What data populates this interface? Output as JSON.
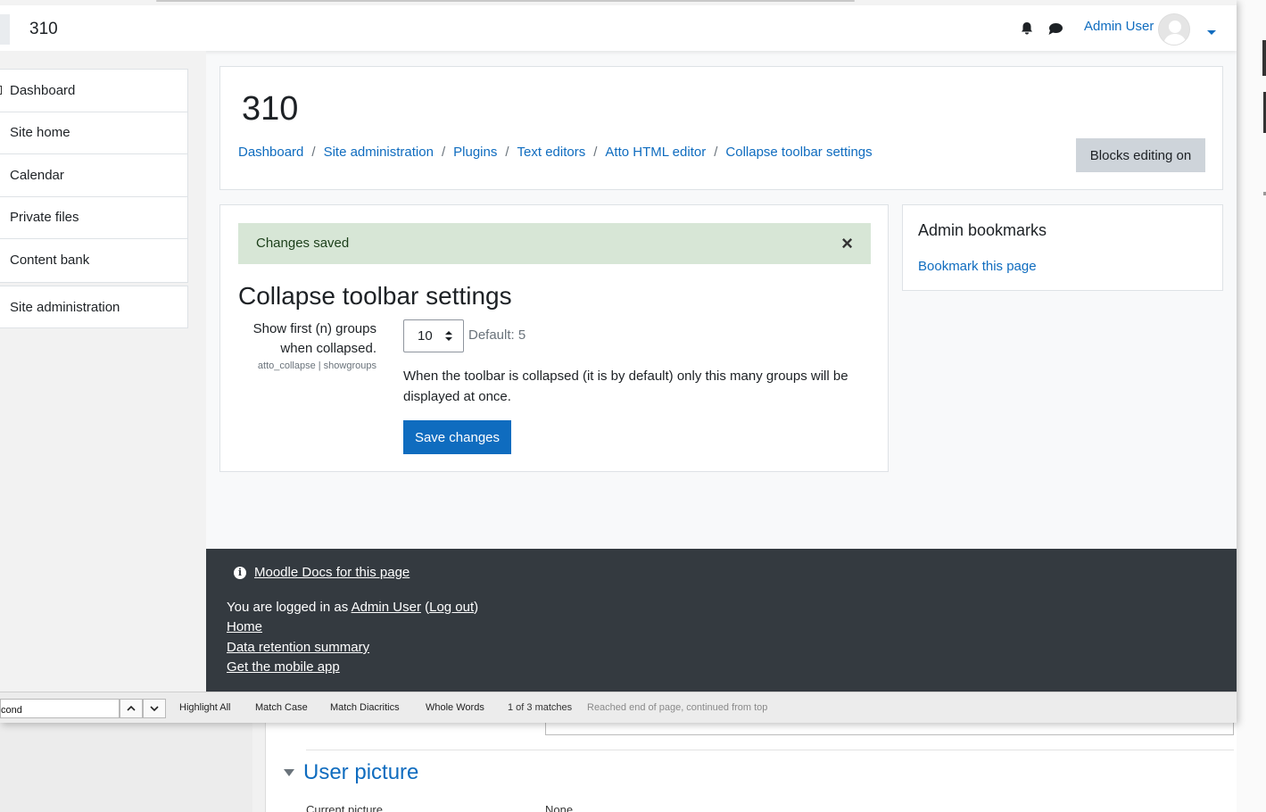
{
  "navbar": {
    "site_name": "310",
    "user_name": "Admin User"
  },
  "drawer": {
    "items": [
      {
        "label": "Dashboard"
      },
      {
        "label": "Site home"
      },
      {
        "label": "Calendar"
      },
      {
        "label": "Private files"
      },
      {
        "label": "Content bank"
      }
    ],
    "admin_item": "Site administration"
  },
  "header": {
    "title": "310",
    "breadcrumb": [
      "Dashboard",
      "Site administration",
      "Plugins",
      "Text editors",
      "Atto HTML editor",
      "Collapse toolbar settings"
    ],
    "blocks_editing_label": "Blocks editing on"
  },
  "alert": {
    "message": "Changes saved",
    "close": "×"
  },
  "settings": {
    "heading": "Collapse toolbar settings",
    "label_line1": "Show first (n) groups",
    "label_line2": "when collapsed.",
    "setting_name": "atto_collapse | showgroups",
    "value": "10",
    "default": "Default: 5",
    "description": "When the toolbar is collapsed (it is by default) only this many groups will be displayed at once.",
    "save_label": "Save changes"
  },
  "block": {
    "title": "Admin bookmarks",
    "link": "Bookmark this page"
  },
  "footer": {
    "docs_link": "Moodle Docs for this page",
    "logged_in_prefix": "You are logged in as ",
    "logged_in_user": "Admin User",
    "logout": "Log out",
    "links": [
      "Home",
      "Data retention summary",
      "Get the mobile app"
    ]
  },
  "findbar": {
    "query": "cond",
    "options": [
      "Highlight All",
      "Match Case",
      "Match Diacritics",
      "Whole Words"
    ],
    "count": "1 of 3 matches",
    "status": "Reached end of page, continued from top"
  },
  "background": {
    "section_title": "User picture",
    "cut_label": "Current picture",
    "cut_value": "None"
  }
}
